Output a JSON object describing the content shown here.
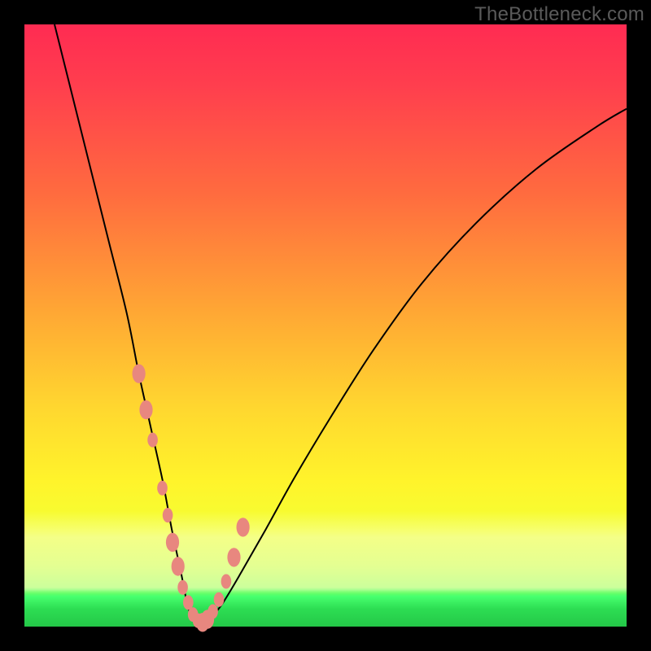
{
  "watermark": "TheBottleneck.com",
  "colors": {
    "frame": "#000000",
    "bead": "#e8877f",
    "curve": "#000000",
    "gradient_top": "#ff2b52",
    "gradient_mid": "#fff42b",
    "gradient_green": "#47ff6e"
  },
  "chart_data": {
    "type": "line",
    "title": "",
    "xlabel": "",
    "ylabel": "",
    "xlim": [
      0,
      100
    ],
    "ylim": [
      0,
      100
    ],
    "grid": false,
    "legend": false,
    "annotations": [
      "TheBottleneck.com"
    ],
    "series": [
      {
        "name": "bottleneck-curve",
        "x": [
          5,
          8,
          11,
          14,
          17,
          19,
          21,
          23,
          24.5,
          26,
          27,
          28,
          29.5,
          31,
          33,
          36,
          40,
          45,
          51,
          58,
          66,
          75,
          85,
          95,
          100
        ],
        "y": [
          100,
          88,
          76,
          64,
          52,
          42,
          33,
          24,
          16,
          9,
          4,
          1,
          0.5,
          1.5,
          4,
          9,
          16,
          25,
          35,
          46,
          57,
          67,
          76,
          83,
          86
        ]
      }
    ],
    "beads": {
      "name": "highlight-beads",
      "x": [
        19.0,
        20.2,
        21.3,
        22.9,
        23.8,
        24.6,
        25.5,
        26.3,
        27.2,
        28.0,
        28.8,
        29.6,
        30.4,
        31.3,
        32.3,
        33.5,
        34.8,
        36.3
      ],
      "y": [
        42.0,
        36.0,
        31.0,
        23.0,
        18.5,
        14.0,
        10.0,
        6.5,
        4.0,
        2.0,
        1.0,
        0.7,
        1.2,
        2.5,
        4.5,
        7.5,
        11.5,
        16.5
      ],
      "r": [
        13,
        13,
        10,
        10,
        10,
        13,
        13,
        10,
        10,
        10,
        10,
        13,
        13,
        10,
        10,
        10,
        13,
        13
      ]
    }
  }
}
